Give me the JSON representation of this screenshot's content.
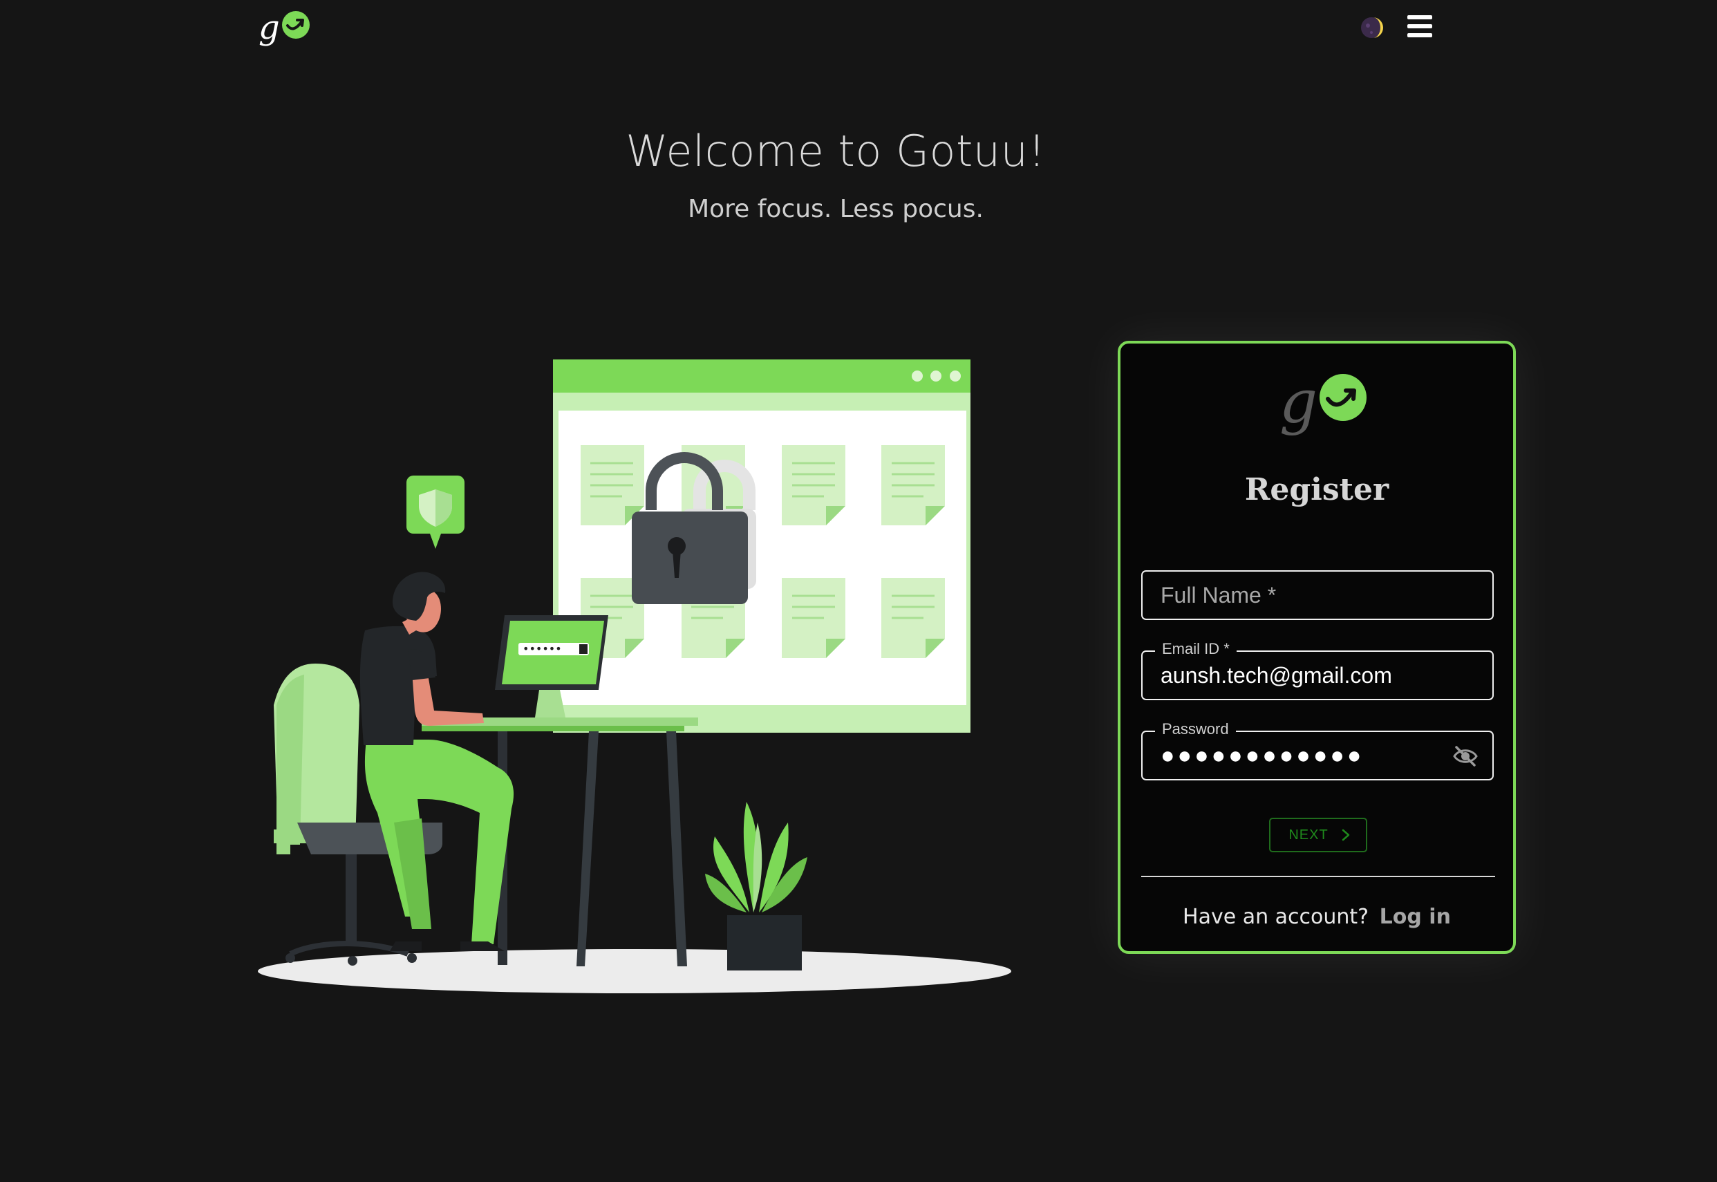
{
  "brand": {
    "logo_text": "Go"
  },
  "header": {
    "title": "Welcome to Gotuu!",
    "subtitle": "More focus. Less pocus."
  },
  "illustration": {
    "screen_password_mask": "••••••"
  },
  "register": {
    "title": "Register",
    "fields": {
      "full_name": {
        "label": "Full Name *",
        "value": ""
      },
      "email": {
        "label": "Email ID *",
        "value": "aunsh.tech@gmail.com"
      },
      "password": {
        "label": "Password",
        "value": "●●●●●●●●●●●●"
      }
    },
    "next_label": "NEXT",
    "login_prompt": "Have an account?",
    "login_link": "Log in"
  },
  "colors": {
    "background": "#151515",
    "accent_green": "#7dd957",
    "card_background": "#060606",
    "next_button": "#1f8a1c"
  },
  "icons": {
    "theme_toggle": "moon-icon",
    "menu": "hamburger-menu-icon",
    "password_visibility": "eye-off-icon",
    "next": "chevron-right-icon"
  }
}
